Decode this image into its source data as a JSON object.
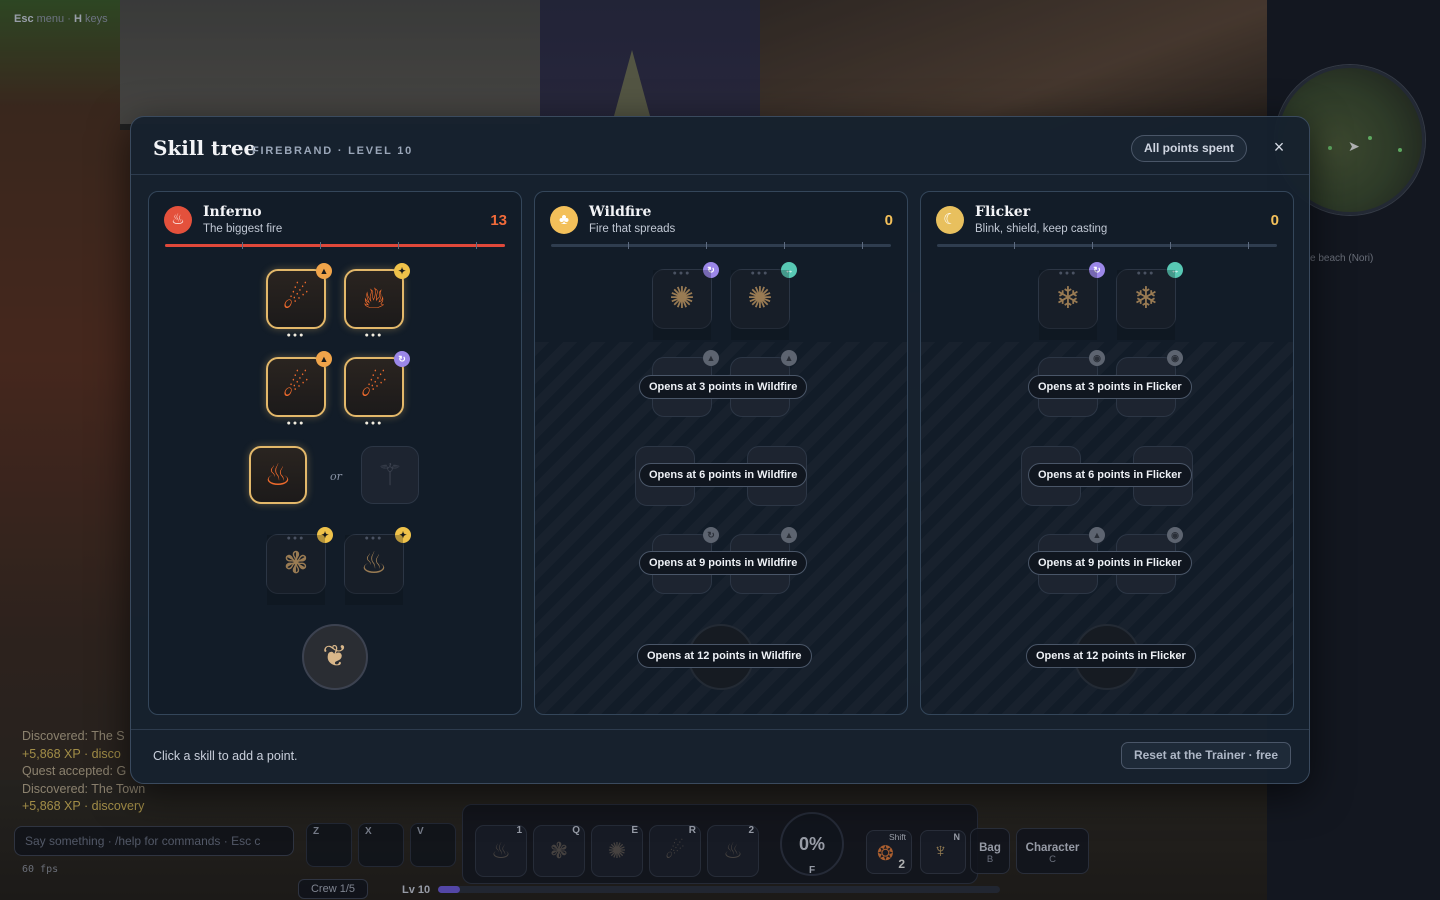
{
  "hud": {
    "hint_esc_key": "Esc",
    "hint_esc_label": "menu",
    "hint_sep": "·",
    "hint_h_key": "H",
    "hint_h_label": "keys",
    "quest_location_sub": "e beach (Nori)",
    "log": [
      {
        "text": "Discovered: The S",
        "kind": "discover"
      },
      {
        "text": "+5,868 XP · disco",
        "kind": "xp"
      },
      {
        "text": "Quest accepted: G",
        "kind": "discover"
      },
      {
        "text": "Discovered: The Town",
        "kind": "discover"
      },
      {
        "text": "+5,868 XP · discovery",
        "kind": "xp"
      }
    ],
    "chat_placeholder": "Say something · /help for commands · Esc c",
    "fps": "60 fps",
    "hotkeys": [
      "Z",
      "X",
      "V"
    ],
    "crew": "Crew 1/5",
    "level": "Lv 10",
    "xp_progress": 0.04,
    "action_slots": [
      {
        "key": "1",
        "icon": "fire-icon"
      },
      {
        "key": "Q",
        "icon": "ember-cluster-icon"
      },
      {
        "key": "E",
        "icon": "spark-burst-icon"
      },
      {
        "key": "R",
        "icon": "fireball-icon"
      },
      {
        "key": "2",
        "icon": "flame-icon"
      }
    ],
    "ultimate_pct": "0%",
    "ultimate_key": "F",
    "shift_key": "Shift",
    "shift_count": "2",
    "n_key": "N",
    "bag_label": "Bag",
    "bag_key": "B",
    "character_label": "Character",
    "character_key": "C"
  },
  "modal": {
    "title": "Skill tree",
    "subtitle": "FIREBRAND · LEVEL 10",
    "status_pill": "All points spent",
    "close_label": "×",
    "footer_hint": "Click a skill to add a point.",
    "reset_label": "Reset at the Trainer · free"
  },
  "trees": [
    {
      "name": "Inferno",
      "desc": "The biggest fire",
      "points": "13",
      "progress": 1.0,
      "accent": "#e0483a",
      "icon": "flame-icon",
      "or_label": "or"
    },
    {
      "name": "Wildfire",
      "desc": "Fire that spreads",
      "points": "0",
      "progress": 0,
      "accent": "#efc24a",
      "icon": "wildfire-icon",
      "locks": [
        "Opens at 3 points in Wildfire",
        "Opens at 6 points in Wildfire",
        "Opens at 9 points in Wildfire",
        "Opens at 12 points in Wildfire"
      ]
    },
    {
      "name": "Flicker",
      "desc": "Blink, shield, keep casting",
      "points": "0",
      "progress": 0,
      "accent": "#efc24a",
      "icon": "flicker-icon",
      "locks": [
        "Opens at 3 points in Flicker",
        "Opens at 6 points in Flicker",
        "Opens at 9 points in Flicker",
        "Opens at 12 points in Flicker"
      ]
    }
  ]
}
